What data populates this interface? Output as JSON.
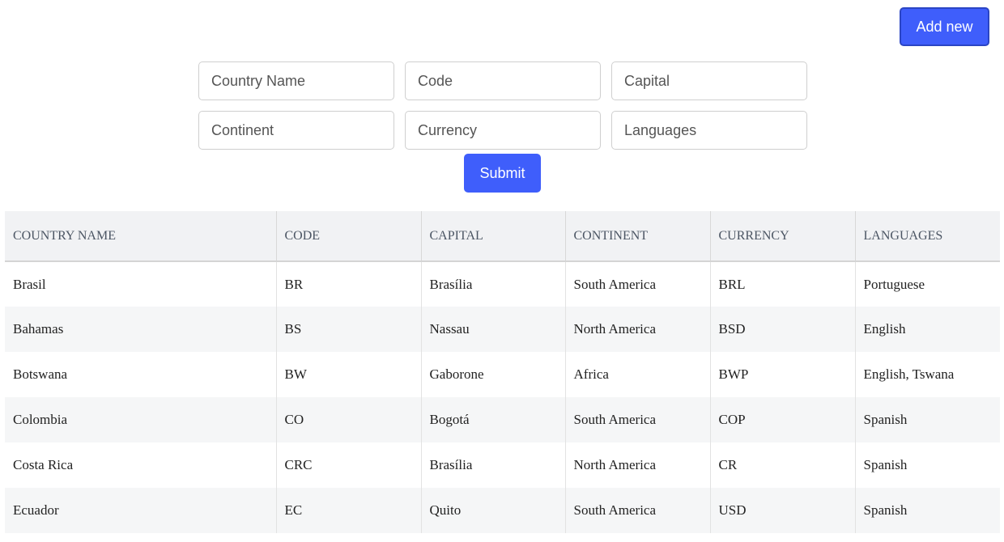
{
  "toolbar": {
    "add_new_label": "Add new"
  },
  "form": {
    "country_name_placeholder": "Country Name",
    "code_placeholder": "Code",
    "capital_placeholder": "Capital",
    "continent_placeholder": "Continent",
    "currency_placeholder": "Currency",
    "languages_placeholder": "Languages",
    "submit_label": "Submit"
  },
  "table": {
    "headers": [
      "COUNTRY NAME",
      "CODE",
      "CAPITAL",
      "CONTINENT",
      "CURRENCY",
      "LANGUAGES"
    ],
    "rows": [
      [
        "Brasil",
        "BR",
        "Brasília",
        "South America",
        "BRL",
        "Portuguese"
      ],
      [
        "Bahamas",
        "BS",
        "Nassau",
        "North America",
        "BSD",
        "English"
      ],
      [
        "Botswana",
        "BW",
        "Gaborone",
        "Africa",
        "BWP",
        "English, Tswana"
      ],
      [
        "Colombia",
        "CO",
        "Bogotá",
        "South America",
        "COP",
        "Spanish"
      ],
      [
        "Costa Rica",
        "CRC",
        "Brasília",
        "North America",
        "CR",
        "Spanish"
      ],
      [
        "Ecuador",
        "EC",
        "Quito",
        "South America",
        "USD",
        "Spanish"
      ]
    ]
  },
  "colors": {
    "accent": "#3f5efb",
    "header_bg": "#f1f2f4",
    "stripe_bg": "#f5f6f7"
  }
}
